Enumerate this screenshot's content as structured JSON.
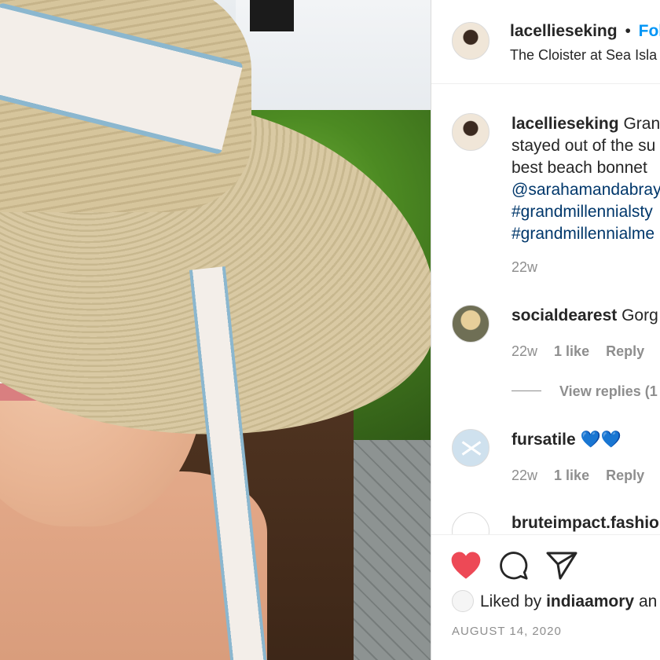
{
  "header": {
    "username": "lacellieseking",
    "separator": "•",
    "follow_label": "Fol",
    "location": "The Cloister at Sea Isla"
  },
  "caption": {
    "username": "lacellieseking",
    "line1": "Gran",
    "line2": "stayed out of the su",
    "line3": "best beach bonnet",
    "mention": "@sarahamandabray",
    "hashtag1": "#grandmillennialsty",
    "hashtag2": "#grandmillennialme",
    "time": "22w"
  },
  "comments": [
    {
      "username": "socialdearest",
      "text": "Gorg",
      "time": "22w",
      "likes": "1 like",
      "reply": "Reply"
    },
    {
      "username": "fursatile",
      "text": "💙💙",
      "time": "22w",
      "likes": "1 like",
      "reply": "Reply"
    },
    {
      "username": "bruteimpact.fashio"
    }
  ],
  "view_replies": "View replies (1",
  "actions": {
    "liked_prefix": "Liked by",
    "liked_user": "indiaamory",
    "liked_suffix": "an"
  },
  "date": "AUGUST 14, 2020",
  "colors": {
    "like_red": "#ed4956",
    "link_blue": "#00376b",
    "follow_blue": "#0095f6"
  }
}
